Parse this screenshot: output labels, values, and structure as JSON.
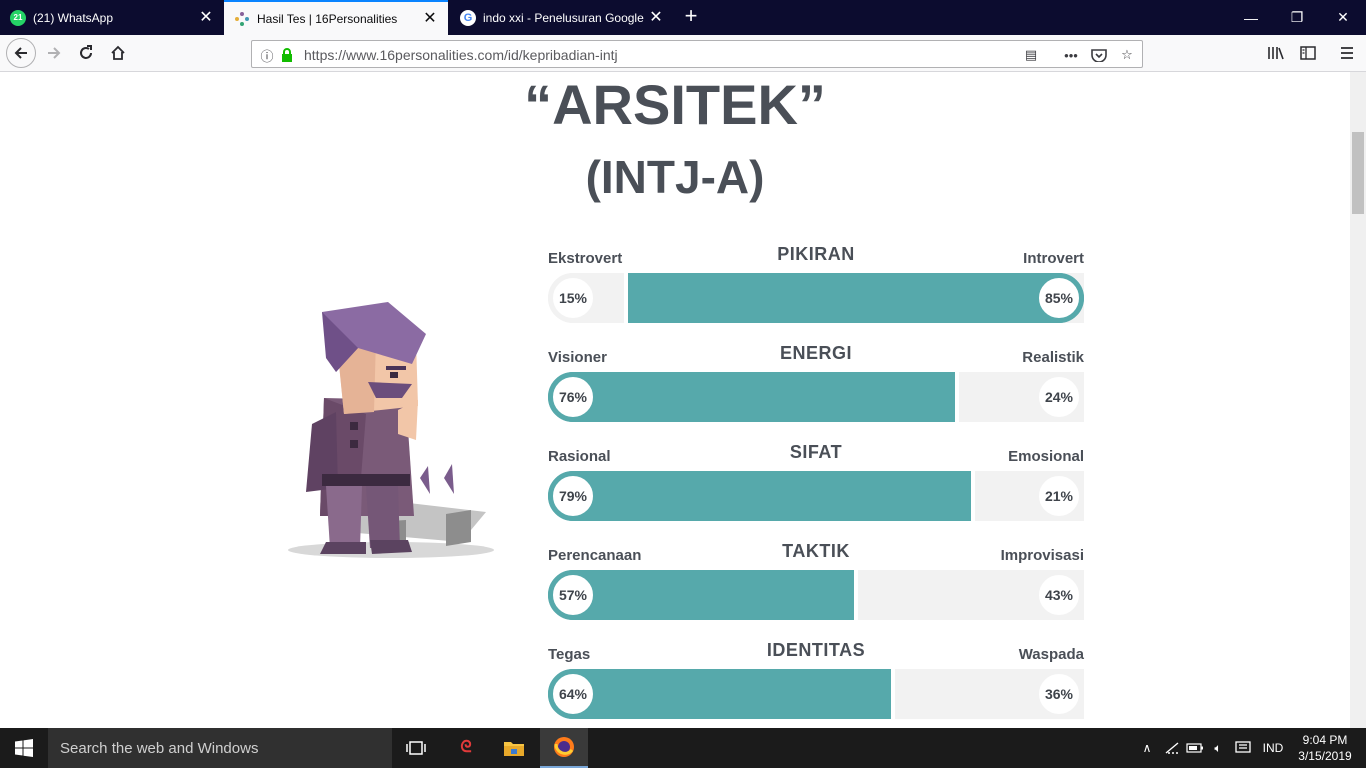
{
  "browser": {
    "tabs": [
      {
        "title": "(21) WhatsApp",
        "badge": "21"
      },
      {
        "title": "Hasil Tes | 16Personalities"
      },
      {
        "title": "indo xxi - Penelusuran Google"
      }
    ],
    "url": "https://www.16personalities.com/id/kepribadian-intj"
  },
  "page": {
    "title": "“ARSITEK”",
    "subtitle": "(INTJ-A)",
    "dimensions": [
      {
        "name": "PIKIRAN",
        "left_label": "Ekstrovert",
        "right_label": "Introvert",
        "left_pct": "15%",
        "right_pct": "85%",
        "dominant": "right",
        "value": 85
      },
      {
        "name": "ENERGI",
        "left_label": "Visioner",
        "right_label": "Realistik",
        "left_pct": "76%",
        "right_pct": "24%",
        "dominant": "left",
        "value": 76
      },
      {
        "name": "SIFAT",
        "left_label": "Rasional",
        "right_label": "Emosional",
        "left_pct": "79%",
        "right_pct": "21%",
        "dominant": "left",
        "value": 79
      },
      {
        "name": "TAKTIK",
        "left_label": "Perencanaan",
        "right_label": "Improvisasi",
        "left_pct": "57%",
        "right_pct": "43%",
        "dominant": "left",
        "value": 57
      },
      {
        "name": "IDENTITAS",
        "left_label": "Tegas",
        "right_label": "Waspada",
        "left_pct": "64%",
        "right_pct": "36%",
        "dominant": "left",
        "value": 64
      }
    ],
    "accent_color": "#56a9ab"
  },
  "taskbar": {
    "search_placeholder": "Search the web and Windows",
    "language": "IND",
    "time": "9:04 PM",
    "date": "3/15/2019"
  }
}
